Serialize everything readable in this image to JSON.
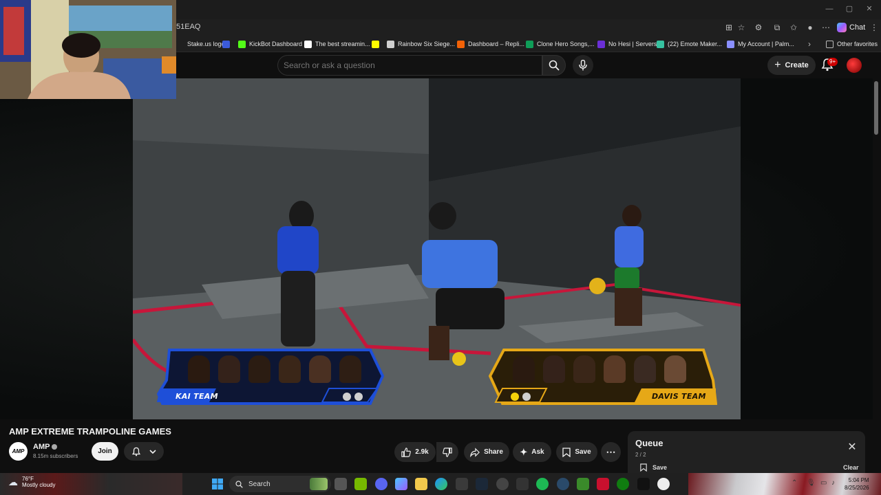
{
  "browser": {
    "url_fragment": "51EAQ",
    "chat_label": "Chat",
    "bookmarks": [
      {
        "label": "Stake.us logo",
        "color": "#1f1f1f"
      },
      {
        "label": "",
        "color": "#3b5bdb"
      },
      {
        "label": "KickBot Dashboard",
        "color": "#53fc18"
      },
      {
        "label": "The best streamin...",
        "color": "#ffffff"
      },
      {
        "label": "",
        "color": "#fffc00"
      },
      {
        "label": "Rainbow Six Siege...",
        "color": "#cfcfcf"
      },
      {
        "label": "Dashboard – Repli...",
        "color": "#f26207"
      },
      {
        "label": "Clone Hero Songs,...",
        "color": "#0f9d58"
      },
      {
        "label": "No Hesi | Servers",
        "color": "#6b2fd6"
      },
      {
        "label": "(22) Emote Maker...",
        "color": "#36c2a0"
      },
      {
        "label": "My Account | Palm...",
        "color": "#8a8fff"
      }
    ],
    "other_favorites": "Other favorites"
  },
  "youtube": {
    "search_placeholder": "Search or ask a question",
    "create_label": "Create",
    "notification_badge": "9+"
  },
  "video": {
    "left_team": {
      "name": "KAI TEAM",
      "accent": "#1e4fd8",
      "score_dots": [
        "#cfcfcf",
        "#cfcfcf"
      ]
    },
    "right_team": {
      "name": "DAVIS TEAM",
      "accent": "#e6a817",
      "score_dots": [
        "#f5d20a",
        "#cfcfcf"
      ]
    },
    "title": "AMP EXTREME TRAMPOLINE GAMES",
    "channel": {
      "name": "AMP",
      "avatar_text": "AMP",
      "subscribers": "8.15m subscribers",
      "join_label": "Join"
    },
    "actions": {
      "likes": "2.9k",
      "share": "Share",
      "ask": "Ask",
      "save": "Save"
    }
  },
  "queue": {
    "title": "Queue",
    "count": "2 / 2",
    "save_label": "Save",
    "clear_label": "Clear"
  },
  "taskbar": {
    "weather_temp": "76°F",
    "weather_desc": "Mostly cloudy",
    "search_label": "Search",
    "time": "5:04 PM",
    "date": "8/25/2026"
  }
}
